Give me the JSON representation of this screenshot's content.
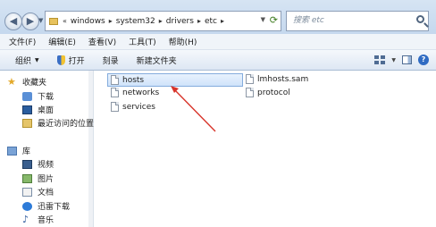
{
  "address": {
    "overflow": "«",
    "crumbs": [
      "windows",
      "system32",
      "drivers",
      "etc"
    ]
  },
  "search": {
    "placeholder": "搜索 etc"
  },
  "menu": [
    "文件(F)",
    "编辑(E)",
    "查看(V)",
    "工具(T)",
    "帮助(H)"
  ],
  "toolbar": {
    "organize": "组织",
    "open": "打开",
    "burn": "刻录",
    "new_folder": "新建文件夹"
  },
  "nav": {
    "favorites": "收藏夹",
    "downloads": "下载",
    "desktop": "桌面",
    "recent": "最近访问的位置",
    "libraries": "库",
    "videos": "视频",
    "pictures": "图片",
    "documents": "文档",
    "thunder": "迅雷下载",
    "music": "音乐"
  },
  "files": [
    "hosts",
    "networks",
    "services",
    "lmhosts.sam",
    "protocol"
  ],
  "colors": {
    "annotation_arrow": "#d8342a",
    "selection_border": "#84acdd",
    "toolbar_bg": "#dde7f3"
  },
  "icons": {
    "back": "back-arrow-icon",
    "forward": "forward-arrow-icon",
    "search": "search-icon",
    "help": "help-icon"
  }
}
